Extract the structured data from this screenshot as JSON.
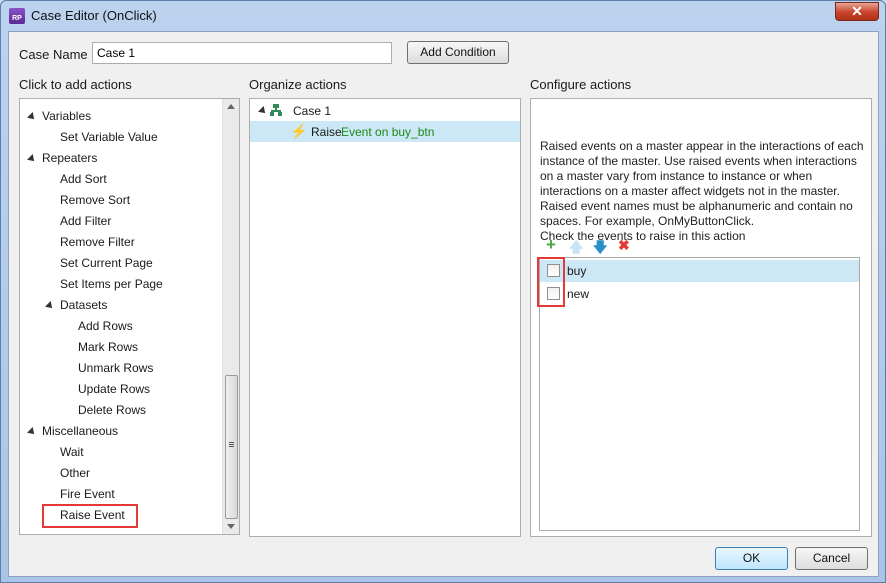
{
  "window": {
    "title": "Case Editor (OnClick)",
    "app_icon_text": "RP",
    "close_glyph": "✕"
  },
  "case_name": {
    "label": "Case Name",
    "value": "Case 1",
    "add_condition_label": "Add Condition"
  },
  "left_panel": {
    "heading": "Click to add actions",
    "items": [
      {
        "label": "Variables",
        "level": 0,
        "expandable": true
      },
      {
        "label": "Set Variable Value",
        "level": 1
      },
      {
        "label": "Repeaters",
        "level": 0,
        "expandable": true
      },
      {
        "label": "Add Sort",
        "level": 1
      },
      {
        "label": "Remove Sort",
        "level": 1
      },
      {
        "label": "Add Filter",
        "level": 1
      },
      {
        "label": "Remove Filter",
        "level": 1
      },
      {
        "label": "Set Current Page",
        "level": 1
      },
      {
        "label": "Set Items per Page",
        "level": 1
      },
      {
        "label": "Datasets",
        "level": 1,
        "expandable": true
      },
      {
        "label": "Add Rows",
        "level": 2
      },
      {
        "label": "Mark Rows",
        "level": 2
      },
      {
        "label": "Unmark Rows",
        "level": 2
      },
      {
        "label": "Update Rows",
        "level": 2
      },
      {
        "label": "Delete Rows",
        "level": 2
      },
      {
        "label": "Miscellaneous",
        "level": 0,
        "expandable": true
      },
      {
        "label": "Wait",
        "level": 1
      },
      {
        "label": "Other",
        "level": 1
      },
      {
        "label": "Fire Event",
        "level": 1
      },
      {
        "label": "Raise Event",
        "level": 1,
        "highlighted": true
      }
    ]
  },
  "middle_panel": {
    "heading": "Organize actions",
    "case_label": "Case 1",
    "action_verb": "Raise",
    "action_detail": "Event on buy_btn"
  },
  "right_panel": {
    "heading": "Configure actions",
    "description": [
      "Raised events on a master appear in the interactions of each instance of the master. Use raised events when interactions on a master vary from instance to instance or when interactions on a master affect widgets not in the master.",
      "Raised event names must be alphanumeric and contain no spaces. For example, OnMyButtonClick.",
      "Check the events to raise in this action"
    ],
    "toolbar": {
      "add": "+",
      "up": "🡅",
      "down": "🡇",
      "delete": "✖"
    },
    "events": [
      {
        "name": "buy",
        "checked": false,
        "selected": true
      },
      {
        "name": "new",
        "checked": false,
        "selected": false
      }
    ]
  },
  "footer": {
    "ok_label": "OK",
    "cancel_label": "Cancel"
  },
  "colors": {
    "highlight": "#e53935",
    "selection": "#cce8f6",
    "action_detail": "#1a8a1a"
  }
}
